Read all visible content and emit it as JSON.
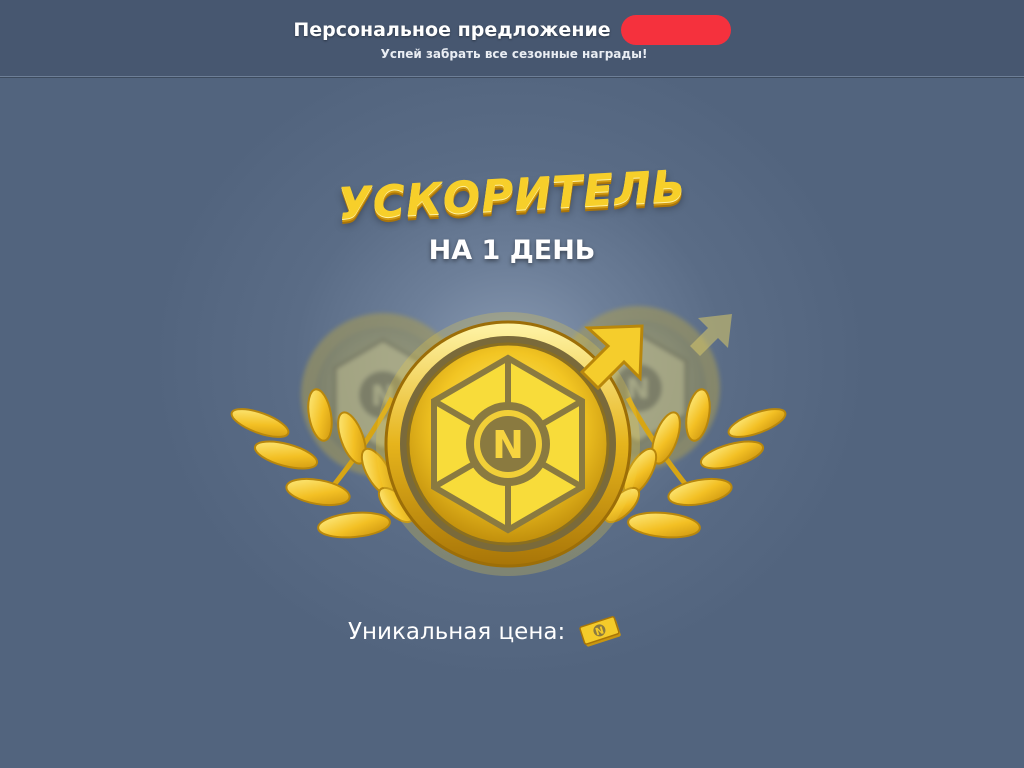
{
  "header": {
    "offer_title": "Персональное предложение",
    "timer_badge": "",
    "subtitle": "Успей забрать все сезонные награды!"
  },
  "promo": {
    "title": "УСКОРИТЕЛЬ",
    "duration": "НА 1 ДЕНЬ",
    "coin_letter": "N",
    "ghost_coin_letter": "N"
  },
  "price": {
    "label": "Уникальная цена:",
    "icon": "gold-banknote-icon",
    "note_letter": "N"
  },
  "colors": {
    "background": "#52647e",
    "header_bg": "#475770",
    "timer_badge": "#f5313d",
    "gold": "#f7cf2a",
    "gold_dark": "#b8870c"
  }
}
